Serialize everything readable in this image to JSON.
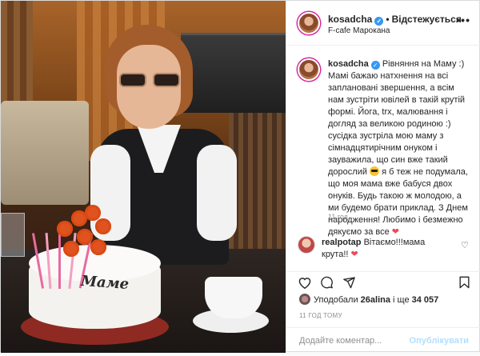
{
  "header": {
    "username": "kosadcha",
    "follow_label": "Відстежується",
    "location": "F-cafe Марокана",
    "more": "•••"
  },
  "caption": {
    "username": "kosadcha",
    "text_a": "Рівняння на Маму :) Мамі бажаю натхнення на всі заплановані звершення, а всім нам зустріти ювілей в такій крутій формі. Йога, trx, малювання і догляд за великою родиною :) сусідка зустріла мою маму з сімнадцятирічним онуком і зауважила, що син вже такий дорослий",
    "text_b": "я б теж не подумала, що моя мама вже бабуся двох онуків. Будь такою ж молодою, а ми будемо брати приклад. З Днем народження! Любимо і безмежно дякуємо за все",
    "time": "11 год."
  },
  "comment": {
    "username": "realpotap",
    "text": "Вітаємо!!!мама крута!!"
  },
  "likes": {
    "prefix": "Уподобали",
    "user": "26alina",
    "middle": "і ще",
    "count": "34 057"
  },
  "post_time": "11 ГОД ТОМУ",
  "add_comment": {
    "placeholder": "Додайте коментар...",
    "post_label": "Опублікувати"
  },
  "photo": {
    "cake_text": "Маме"
  },
  "colors": {
    "verified": "#3897f0",
    "heart": "#ed4956",
    "post_button_disabled": "#b2dffc",
    "muted": "#8e8e8e"
  },
  "icons": [
    "heart-icon",
    "comment-icon",
    "share-icon",
    "bookmark-icon",
    "verified-icon",
    "more-options-icon"
  ]
}
